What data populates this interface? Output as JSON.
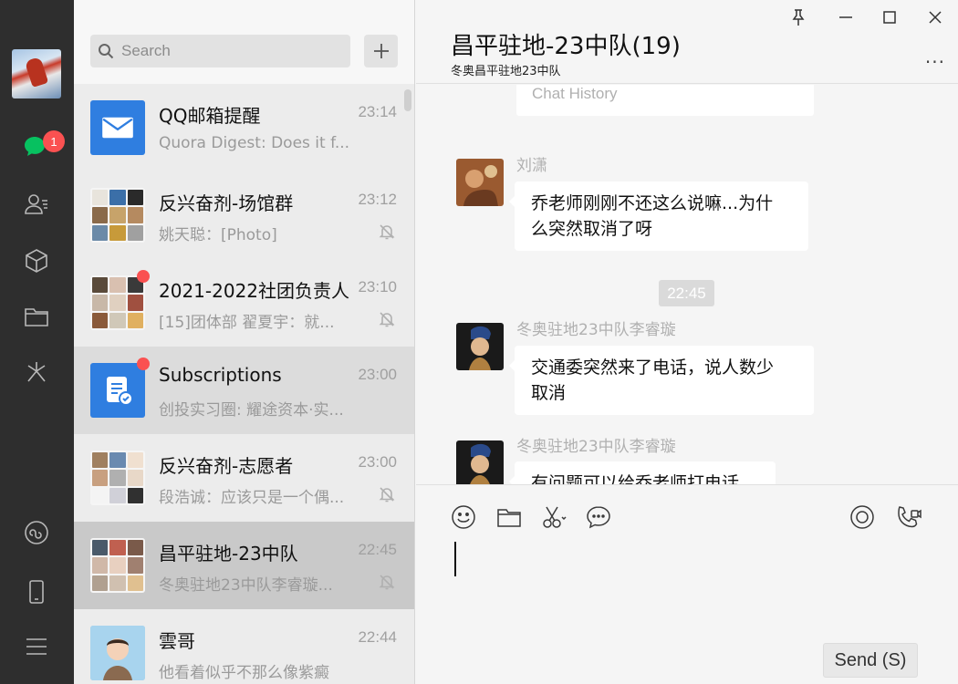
{
  "rail": {
    "unread_badge": "1",
    "icons": [
      "chats-icon",
      "contacts-icon",
      "favorites-icon",
      "files-icon",
      "moments-icon",
      "mini-programs-icon",
      "phone-icon",
      "menu-icon"
    ]
  },
  "search": {
    "placeholder": "Search"
  },
  "chats": [
    {
      "name": "QQ邮箱提醒",
      "time": "23:14",
      "preview": "Quora Digest: Does it f..."
    },
    {
      "name": "反兴奋剂-场馆群",
      "time": "23:12",
      "preview": "姚天聪：[Photo]"
    },
    {
      "name": "2021-2022社团负责人",
      "time": "23:10",
      "preview": "[15]团体部 翟夏宇：就..."
    },
    {
      "name": "Subscriptions",
      "time": "23:00",
      "preview": "创投实习圈: 耀途资本·实..."
    },
    {
      "name": "反兴奋剂-志愿者",
      "time": "23:00",
      "preview": "段浩诚：应该只是一个偶..."
    },
    {
      "name": "昌平驻地-23中队",
      "time": "22:45",
      "preview": "冬奥驻地23中队李睿璇..."
    },
    {
      "name": "雲哥",
      "time": "22:44",
      "preview": "他看着似乎不那么像紫癜"
    }
  ],
  "chat": {
    "title": "昌平驻地-23中队(19)",
    "subtitle": "冬奥昌平驻地23中队",
    "more": "···",
    "history_label": "Chat History",
    "timestamp": "22:45",
    "messages": [
      {
        "sender": "刘潇",
        "lines": [
          "乔老师刚刚不还这么说嘛...为什",
          "么突然取消了呀"
        ]
      },
      {
        "sender": "冬奥驻地23中队李睿璇",
        "lines": [
          "交通委突然来了电话，说人数少",
          "取消"
        ]
      },
      {
        "sender": "冬奥驻地23中队李睿璇",
        "lines": [
          "有问题可以给乔老师打电话"
        ]
      }
    ],
    "send_label": "Send (S)"
  },
  "colors": {
    "accent_green": "#07c160",
    "badge_red": "#fa5151",
    "rail_bg": "#2e2e2e",
    "tile_blue": "#2f7ee0"
  }
}
